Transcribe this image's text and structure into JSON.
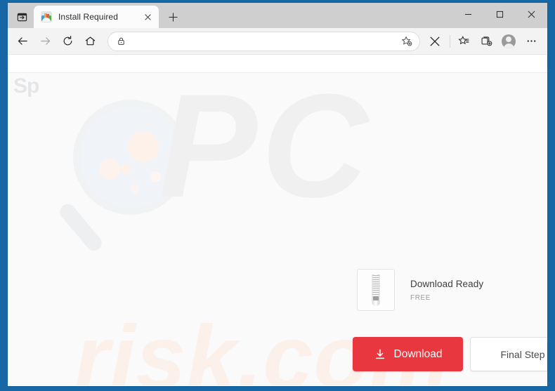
{
  "window": {
    "frame_color": "#1667a6",
    "controls": {
      "minimize_label": "─",
      "maximize_label": "□",
      "close_label": "✕"
    }
  },
  "tabstrip": {
    "tab_actions_name": "tab-actions",
    "tabs": [
      {
        "title": "Install Required",
        "favicon": "colorful-site-icon",
        "close_label": "✕",
        "active": true
      }
    ],
    "new_tab_label": "+"
  },
  "toolbar": {
    "back_label": "←",
    "forward_label": "→",
    "refresh_label": "↻",
    "home_label": "⌂",
    "address": {
      "value": "",
      "placeholder": "",
      "lock_icon": "lock-icon",
      "favorite_icon": "add-favorite-star-icon"
    },
    "stop_label": "✕",
    "favorites_icon": "favorites-star-icon",
    "collections_icon": "collections-icon",
    "profile_icon": "profile-avatar-icon",
    "settings_label": "⋯"
  },
  "page": {
    "background_color": "#fafafa",
    "logo_fragment": "Sp",
    "watermark_primary": "PC",
    "watermark_secondary": "risk.com",
    "watermark_primary_color": "#f0f0f0",
    "watermark_secondary_color": "#fbf0ea",
    "download_card": {
      "file_icon": "zip-file-icon",
      "title": "Download Ready",
      "subtitle": "FREE"
    },
    "buttons": {
      "download_label": "Download",
      "download_icon": "download-arrow-icon",
      "download_color": "#e8373f",
      "final_step_label": "Final Step"
    }
  }
}
